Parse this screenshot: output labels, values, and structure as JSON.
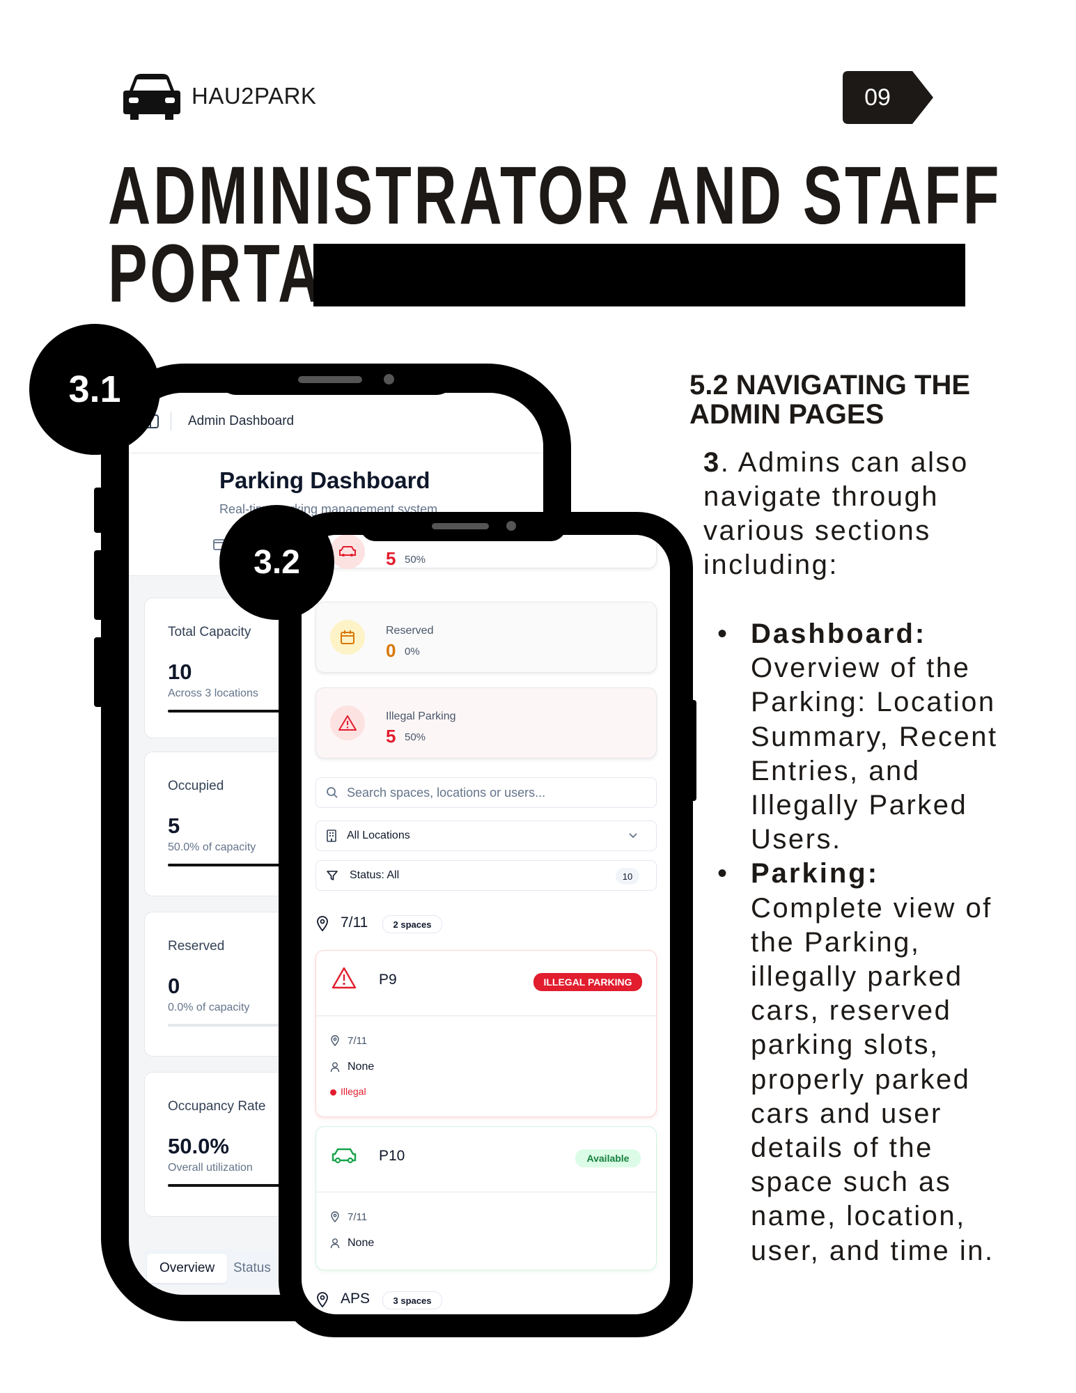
{
  "header": {
    "brand_name": "HAU2PARK",
    "page_number": "09",
    "title_line1": "ADMINISTRATOR AND STAFF",
    "title_line2": "PORTAL"
  },
  "badges": {
    "phone1": "3.1",
    "phone2": "3.2"
  },
  "content": {
    "section_title": "5.2 NAVIGATING THE ADMIN PAGES",
    "intro_number": "3",
    "intro_text": ". Admins can also navigate through various sections including:",
    "bullets": [
      {
        "label": "Dashboard:",
        "text": "Overview of the Parking: Location Summary, Recent Entries, and Illegally Parked Users."
      },
      {
        "label": "Parking:",
        "text": "Complete view of the Parking, illegally parked cars, reserved parking slots, properly parked cars and user details of the space such as name, location, user, and time in."
      }
    ]
  },
  "phone1": {
    "breadcrumb": "Admin Dashboard",
    "page_title": "Parking Dashboard",
    "page_subtitle": "Real-time parking management system",
    "cards": [
      {
        "label": "Total Capacity",
        "value": "10",
        "sub": "Across 3 locations",
        "fill": 1.0
      },
      {
        "label": "Occupied",
        "value": "5",
        "sub": "50.0% of capacity",
        "fill": 1.0
      },
      {
        "label": "Reserved",
        "value": "0",
        "sub": "0.0% of capacity",
        "fill": 0.0
      },
      {
        "label": "Occupancy Rate",
        "value": "50.0%",
        "sub": "Overall utilization",
        "fill": 1.0
      }
    ],
    "tabs": [
      "Overview",
      "Status"
    ]
  },
  "phone2": {
    "top_card": {
      "value": "5",
      "pct": "50%"
    },
    "reserved": {
      "label": "Reserved",
      "value": "0",
      "pct": "0%"
    },
    "illegal": {
      "label": "Illegal Parking",
      "value": "5",
      "pct": "50%"
    },
    "search_placeholder": "Search spaces, locations or users...",
    "location_filter": "All Locations",
    "status_filter": "Status: All",
    "status_count": "10",
    "groups": [
      {
        "name": "7/11",
        "count": "2 spaces"
      },
      {
        "name": "APS",
        "count": "3 spaces"
      }
    ],
    "spots": [
      {
        "name": "P9",
        "tag": "ILLEGAL PARKING",
        "location": "7/11",
        "user": "None",
        "status": "Illegal"
      },
      {
        "name": "P10",
        "tag": "Available",
        "location": "7/11",
        "user": "None"
      }
    ]
  },
  "colors": {
    "danger": "#e11d2e",
    "warning": "#d97706",
    "success": "#16a34a",
    "dark": "#1c1917"
  }
}
